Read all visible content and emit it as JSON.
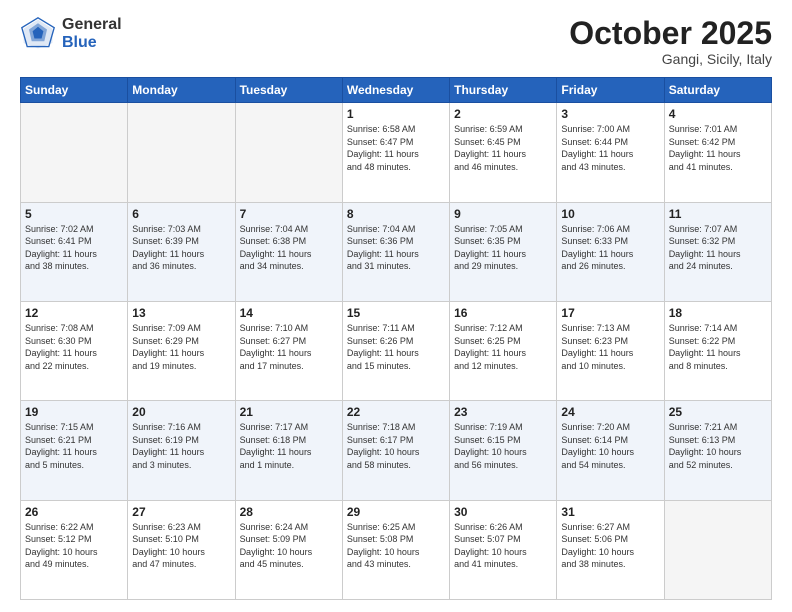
{
  "header": {
    "logo_general": "General",
    "logo_blue": "Blue",
    "month": "October 2025",
    "location": "Gangi, Sicily, Italy"
  },
  "days_of_week": [
    "Sunday",
    "Monday",
    "Tuesday",
    "Wednesday",
    "Thursday",
    "Friday",
    "Saturday"
  ],
  "weeks": [
    [
      {
        "day": "",
        "info": ""
      },
      {
        "day": "",
        "info": ""
      },
      {
        "day": "",
        "info": ""
      },
      {
        "day": "1",
        "info": "Sunrise: 6:58 AM\nSunset: 6:47 PM\nDaylight: 11 hours\nand 48 minutes."
      },
      {
        "day": "2",
        "info": "Sunrise: 6:59 AM\nSunset: 6:45 PM\nDaylight: 11 hours\nand 46 minutes."
      },
      {
        "day": "3",
        "info": "Sunrise: 7:00 AM\nSunset: 6:44 PM\nDaylight: 11 hours\nand 43 minutes."
      },
      {
        "day": "4",
        "info": "Sunrise: 7:01 AM\nSunset: 6:42 PM\nDaylight: 11 hours\nand 41 minutes."
      }
    ],
    [
      {
        "day": "5",
        "info": "Sunrise: 7:02 AM\nSunset: 6:41 PM\nDaylight: 11 hours\nand 38 minutes."
      },
      {
        "day": "6",
        "info": "Sunrise: 7:03 AM\nSunset: 6:39 PM\nDaylight: 11 hours\nand 36 minutes."
      },
      {
        "day": "7",
        "info": "Sunrise: 7:04 AM\nSunset: 6:38 PM\nDaylight: 11 hours\nand 34 minutes."
      },
      {
        "day": "8",
        "info": "Sunrise: 7:04 AM\nSunset: 6:36 PM\nDaylight: 11 hours\nand 31 minutes."
      },
      {
        "day": "9",
        "info": "Sunrise: 7:05 AM\nSunset: 6:35 PM\nDaylight: 11 hours\nand 29 minutes."
      },
      {
        "day": "10",
        "info": "Sunrise: 7:06 AM\nSunset: 6:33 PM\nDaylight: 11 hours\nand 26 minutes."
      },
      {
        "day": "11",
        "info": "Sunrise: 7:07 AM\nSunset: 6:32 PM\nDaylight: 11 hours\nand 24 minutes."
      }
    ],
    [
      {
        "day": "12",
        "info": "Sunrise: 7:08 AM\nSunset: 6:30 PM\nDaylight: 11 hours\nand 22 minutes."
      },
      {
        "day": "13",
        "info": "Sunrise: 7:09 AM\nSunset: 6:29 PM\nDaylight: 11 hours\nand 19 minutes."
      },
      {
        "day": "14",
        "info": "Sunrise: 7:10 AM\nSunset: 6:27 PM\nDaylight: 11 hours\nand 17 minutes."
      },
      {
        "day": "15",
        "info": "Sunrise: 7:11 AM\nSunset: 6:26 PM\nDaylight: 11 hours\nand 15 minutes."
      },
      {
        "day": "16",
        "info": "Sunrise: 7:12 AM\nSunset: 6:25 PM\nDaylight: 11 hours\nand 12 minutes."
      },
      {
        "day": "17",
        "info": "Sunrise: 7:13 AM\nSunset: 6:23 PM\nDaylight: 11 hours\nand 10 minutes."
      },
      {
        "day": "18",
        "info": "Sunrise: 7:14 AM\nSunset: 6:22 PM\nDaylight: 11 hours\nand 8 minutes."
      }
    ],
    [
      {
        "day": "19",
        "info": "Sunrise: 7:15 AM\nSunset: 6:21 PM\nDaylight: 11 hours\nand 5 minutes."
      },
      {
        "day": "20",
        "info": "Sunrise: 7:16 AM\nSunset: 6:19 PM\nDaylight: 11 hours\nand 3 minutes."
      },
      {
        "day": "21",
        "info": "Sunrise: 7:17 AM\nSunset: 6:18 PM\nDaylight: 11 hours\nand 1 minute."
      },
      {
        "day": "22",
        "info": "Sunrise: 7:18 AM\nSunset: 6:17 PM\nDaylight: 10 hours\nand 58 minutes."
      },
      {
        "day": "23",
        "info": "Sunrise: 7:19 AM\nSunset: 6:15 PM\nDaylight: 10 hours\nand 56 minutes."
      },
      {
        "day": "24",
        "info": "Sunrise: 7:20 AM\nSunset: 6:14 PM\nDaylight: 10 hours\nand 54 minutes."
      },
      {
        "day": "25",
        "info": "Sunrise: 7:21 AM\nSunset: 6:13 PM\nDaylight: 10 hours\nand 52 minutes."
      }
    ],
    [
      {
        "day": "26",
        "info": "Sunrise: 6:22 AM\nSunset: 5:12 PM\nDaylight: 10 hours\nand 49 minutes."
      },
      {
        "day": "27",
        "info": "Sunrise: 6:23 AM\nSunset: 5:10 PM\nDaylight: 10 hours\nand 47 minutes."
      },
      {
        "day": "28",
        "info": "Sunrise: 6:24 AM\nSunset: 5:09 PM\nDaylight: 10 hours\nand 45 minutes."
      },
      {
        "day": "29",
        "info": "Sunrise: 6:25 AM\nSunset: 5:08 PM\nDaylight: 10 hours\nand 43 minutes."
      },
      {
        "day": "30",
        "info": "Sunrise: 6:26 AM\nSunset: 5:07 PM\nDaylight: 10 hours\nand 41 minutes."
      },
      {
        "day": "31",
        "info": "Sunrise: 6:27 AM\nSunset: 5:06 PM\nDaylight: 10 hours\nand 38 minutes."
      },
      {
        "day": "",
        "info": ""
      }
    ]
  ]
}
